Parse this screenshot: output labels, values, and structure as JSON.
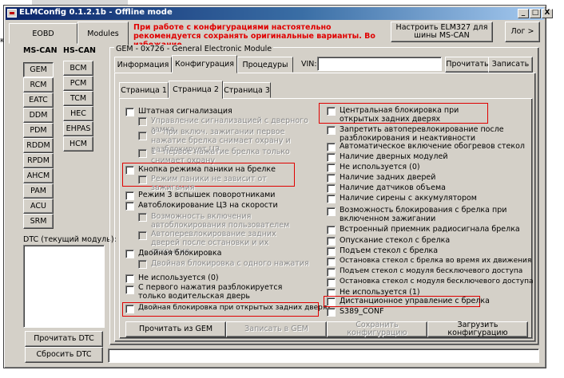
{
  "window": {
    "title": "ELMConfig 0.1.2.1b - Offline mode",
    "caption_buttons": [
      "_",
      "□",
      "X"
    ]
  },
  "behind": {
    "glyph": "ю"
  },
  "top": {
    "tabs": [
      {
        "label": "EOBD",
        "active": false
      },
      {
        "label": "Modules",
        "active": true
      }
    ],
    "warning": "При работе с конфигурациями настоятельно рекомендуется сохранять оригинальные варианты. Во избежание.",
    "setup_button": "Настроить ELM327 для шины MS-CAN",
    "log_button": "Лог >"
  },
  "left": {
    "ms_can_header": "MS-CAN",
    "hs_can_header": "HS-CAN",
    "ms_can_modules": [
      "GEM",
      "RCM",
      "EATC",
      "DDM",
      "PDM",
      "RDDM",
      "RPDM",
      "AHCM",
      "PAM",
      "ACU",
      "SRM"
    ],
    "hs_can_modules": [
      "BCM",
      "PCM",
      "TCM",
      "HEC",
      "EHPAS",
      "HCM"
    ],
    "selected_module": "GEM",
    "dtc_label": "DTC (текущий модуль):",
    "read_dtc": "Прочитать DTC",
    "reset_dtc": "Сбросить DTC"
  },
  "module": {
    "group_title": "GEM - 0x726 - General Electronic Module",
    "tabs": [
      "Информация",
      "Конфигурация",
      "Процедуры"
    ],
    "active_tab": "Конфигурация",
    "vin_label": "VIN:",
    "vin_value": "",
    "read_button": "Прочитать",
    "write_button": "Записать",
    "pages": [
      "Страница 1",
      "Страница 2",
      "Страница 3"
    ],
    "active_page": "Страница 2"
  },
  "options_left": [
    {
      "label": "Штатная сигнализация",
      "enabled": true
    },
    {
      "label": "Управление сигнализацией с дверного замка",
      "enabled": false
    },
    {
      "label": "0 - при включ. зажигании первое нажатие брелка снимает охрану и разблокирует ЦЗ",
      "enabled": false
    },
    {
      "label": "1 - первое нажатие брелка только снимает охрану",
      "enabled": false
    },
    {
      "label": "Кнопка режима паники на брелке",
      "enabled": true
    },
    {
      "label": "Режим паники не зависит от зажигания",
      "enabled": false
    },
    {
      "label": "Режим 3 вспышек поворотниками",
      "enabled": true
    },
    {
      "label": "Автоблокирование ЦЗ на скорости",
      "enabled": true
    },
    {
      "label": "Возможность включения автоблокирования пользователем",
      "enabled": false
    },
    {
      "label": "Автоперевлокирование задних дверей после остановки и их открытия",
      "enabled": false
    },
    {
      "label": "Двойная блокировка",
      "enabled": true
    },
    {
      "label": "Двойная блокировка с одного нажатия",
      "enabled": false
    },
    {
      "label": "Не используется (0)",
      "enabled": true
    },
    {
      "label": "С первого нажатия разблокируется только водительская дверь",
      "enabled": true
    },
    {
      "label": "Двойная блокировка при открытых задних дверях",
      "enabled": true
    }
  ],
  "options_right": [
    {
      "label": "Центральная блокировка при открытых задних дверях",
      "enabled": true
    },
    {
      "label": "Запретить автоперевлокирование после разблокирования и неактивности",
      "enabled": true
    },
    {
      "label": "Автоматическое включение обогревов стекол",
      "enabled": true
    },
    {
      "label": "Наличие дверных модулей",
      "enabled": true
    },
    {
      "label": "Не используется (0)",
      "enabled": true
    },
    {
      "label": "Наличие задних дверей",
      "enabled": true
    },
    {
      "label": "Наличие датчиков объема",
      "enabled": true
    },
    {
      "label": "Наличие сирены с аккумулятором",
      "enabled": true
    },
    {
      "label": "Возможность блокирования с брелка при включенном зажигании",
      "enabled": true
    },
    {
      "label": "Встроенный приемник радиосигнала брелка",
      "enabled": true
    },
    {
      "label": "Опускание стекол с брелка",
      "enabled": true
    },
    {
      "label": "Подъем стекол с брелка",
      "enabled": true
    },
    {
      "label": "Остановка стекол с брелка во время их движения",
      "enabled": true
    },
    {
      "label": "Подъем стекол с модуля бесключевого доступа",
      "enabled": true
    },
    {
      "label": "Остановка стекол с модуля бесключевого доступа",
      "enabled": true
    },
    {
      "label": "Не используется (1)",
      "enabled": true
    },
    {
      "label": "Дистанционное управление с брелка",
      "enabled": true
    },
    {
      "label": "S389_CONF",
      "enabled": true
    }
  ],
  "actions": {
    "read_gem": "Прочитать из GEM",
    "write_gem": "Записать в GEM",
    "save_config": "Сохранить конфигурацию",
    "load_config": "Загрузить конфигурацию"
  },
  "colors": {
    "highlight": "#e00000",
    "title_start": "#0a246a",
    "title_end": "#a6caf0",
    "face": "#d4d0c8"
  }
}
